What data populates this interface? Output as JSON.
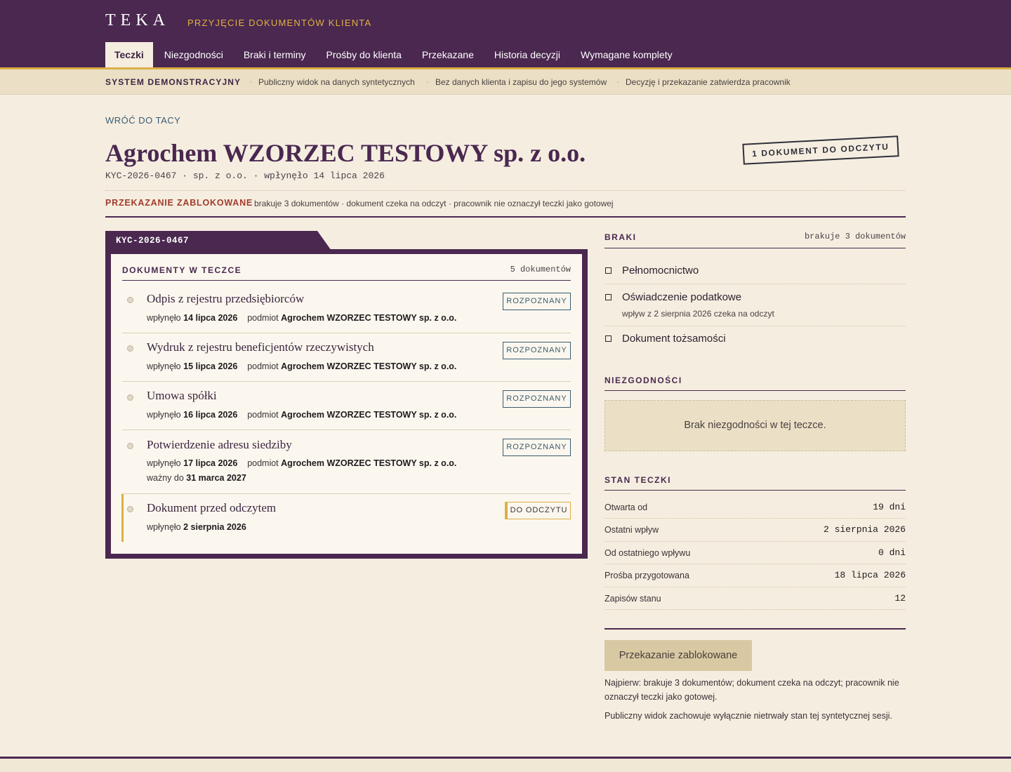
{
  "app": {
    "name": "TEKA",
    "subtitle": "PRZYJĘCIE DOKUMENTÓW KLIENTA"
  },
  "nav": {
    "tabs": [
      "Teczki",
      "Niezgodności",
      "Braki i terminy",
      "Prośby do klienta",
      "Przekazane",
      "Historia decyzji",
      "Wymagane komplety"
    ],
    "active": "Teczki"
  },
  "demo": {
    "title": "SYSTEM DEMONSTRACYJNY",
    "items": [
      "Publiczny widok na danych syntetycznych",
      "Bez danych klienta i zapisu do jego systemów",
      "Decyzję i przekazanie zatwierdza pracownik"
    ]
  },
  "header": {
    "back": "WRÓĆ DO TACY",
    "title": "Agrochem WZORZEC TESTOWY sp. z o.o.",
    "meta": "KYC-2026-0467 · sp. z o.o. · wpłynęło 14 lipca 2026",
    "stamp": "1 DOKUMENT DO ODCZYTU",
    "blocked_label": "PRZEKAZANIE ZABLOKOWANE",
    "blocked_desc": "brakuje 3 dokumentów · dokument czeka na odczyt · pracownik nie oznaczył teczki jako gotowej"
  },
  "folder": {
    "tab_label": "KYC-2026-0467",
    "section_title": "DOKUMENTY W TECZCE",
    "count": "5 dokumentów",
    "docs": [
      {
        "name": "Odpis z rejestru przedsiębiorców",
        "in_label": "wpłynęło",
        "date": "14 lipca 2026",
        "subj_label": "podmiot",
        "subject": "Agrochem WZORZEC TESTOWY sp. z o.o.",
        "badge": "ROZPOZNANY"
      },
      {
        "name": "Wydruk z rejestru beneficjentów rzeczywistych",
        "in_label": "wpłynęło",
        "date": "15 lipca 2026",
        "subj_label": "podmiot",
        "subject": "Agrochem WZORZEC TESTOWY sp. z o.o.",
        "badge": "ROZPOZNANY"
      },
      {
        "name": "Umowa spółki",
        "in_label": "wpłynęło",
        "date": "16 lipca 2026",
        "subj_label": "podmiot",
        "subject": "Agrochem WZORZEC TESTOWY sp. z o.o.",
        "badge": "ROZPOZNANY"
      },
      {
        "name": "Potwierdzenie adresu siedziby",
        "in_label": "wpłynęło",
        "date": "17 lipca 2026",
        "subj_label": "podmiot",
        "subject": "Agrochem WZORZEC TESTOWY sp. z o.o.",
        "badge": "ROZPOZNANY",
        "valid_label": "ważny do",
        "valid": "31 marca 2027"
      },
      {
        "name": "Dokument przed odczytem",
        "in_label": "wpłynęło",
        "date": "2 sierpnia 2026",
        "badge": "DO ODCZYTU"
      }
    ]
  },
  "braki": {
    "title": "BRAKI",
    "count": "brakuje 3 dokumentów",
    "items": [
      {
        "label": "Pełnomocnictwo"
      },
      {
        "label": "Oświadczenie podatkowe",
        "sub": "wpływ z 2 sierpnia 2026 czeka na odczyt"
      },
      {
        "label": "Dokument tożsamości"
      }
    ]
  },
  "niezgodnosci": {
    "title": "NIEZGODNOŚCI",
    "empty": "Brak niezgodności w tej teczce."
  },
  "stan": {
    "title": "STAN TECZKI",
    "rows": [
      {
        "label": "Otwarta od",
        "value": "19 dni"
      },
      {
        "label": "Ostatni wpływ",
        "value": "2 sierpnia 2026"
      },
      {
        "label": "Od ostatniego wpływu",
        "value": "0 dni"
      },
      {
        "label": "Prośba przygotowana",
        "value": "18 lipca 2026"
      },
      {
        "label": "Zapisów stanu",
        "value": "12"
      }
    ]
  },
  "action": {
    "button": "Przekazanie zablokowane",
    "note1": "Najpierw: brakuje 3 dokumentów; dokument czeka na odczyt; pracownik nie oznaczył teczki jako gotowej.",
    "note2": "Publiczny widok zachowuje wyłącznie nietrwały stan tej syntetycznej sesji."
  }
}
